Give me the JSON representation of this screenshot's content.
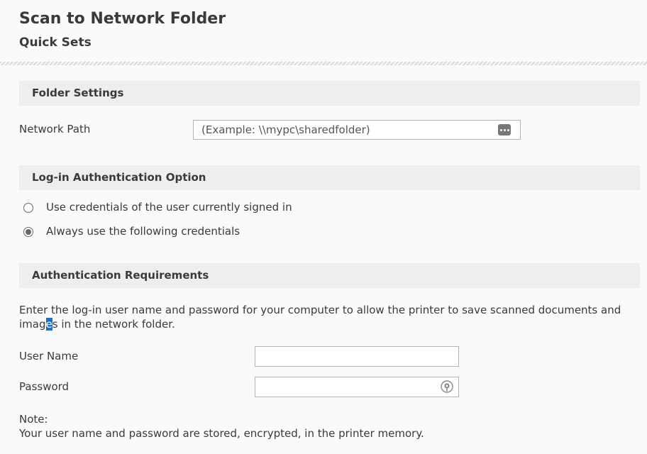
{
  "header": {
    "title": "Scan to Network Folder",
    "subtitle": "Quick Sets"
  },
  "folder_settings": {
    "title": "Folder Settings",
    "network_path_label": "Network Path",
    "network_path_placeholder": "(Example: \\\\mypc\\sharedfolder)",
    "network_path_value": "",
    "path_picker_icon": "ellipsis-icon"
  },
  "login_auth": {
    "title": "Log-in Authentication Option",
    "options": [
      {
        "label": "Use credentials of the user currently signed in",
        "checked": false
      },
      {
        "label": "Always use the following credentials",
        "checked": true
      }
    ]
  },
  "auth_requirements": {
    "title": "Authentication Requirements",
    "description_before": "Enter the log-in user name and password for your computer to allow the printer to save scanned documents and imag",
    "description_selected": "e",
    "description_after": "s in the network folder.",
    "username_label": "User Name",
    "username_value": "",
    "password_label": "Password",
    "password_value": "",
    "password_reveal_icon": "eye-icon",
    "note_title": "Note:",
    "note_text": "Your user name and password are stored, encrypted, in the printer memory."
  }
}
